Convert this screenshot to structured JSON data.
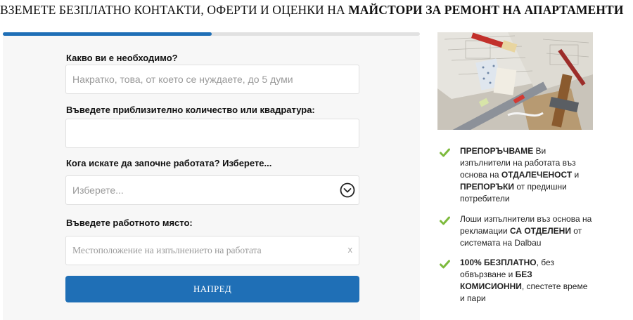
{
  "headline": {
    "normal": "ВЗЕМЕТЕ БЕЗПЛАТНО КОНТАКТИ, ОФЕРТИ И ОЦЕНКИ НА ",
    "bold": "МАЙСТОРИ ЗА РЕМОНТ НА АПАРТАМЕНТИ"
  },
  "progress": {
    "fraction": 0.5,
    "color": "#1f6fb6"
  },
  "form": {
    "need": {
      "label": "Какво ви е необходимо?",
      "placeholder": "Накратко, това, от което се нуждаете, до 5 думи",
      "value": ""
    },
    "quantity": {
      "label": "Въведете приблизително количество или квадратура:",
      "placeholder": "",
      "value": ""
    },
    "start": {
      "label": "Кога искате да започне работата? Изберете...",
      "selected": "Изберете..."
    },
    "location": {
      "label": "Въведете работното място:",
      "placeholder": "Местоположение на изпълнението на работата",
      "clear": "x"
    },
    "submit_label": "НАПРЕД"
  },
  "hero_image": {
    "icon": "renovation-tools-photo"
  },
  "benefits": [
    {
      "parts": [
        {
          "b": true,
          "t": "ПРЕПОРЪЧВАМЕ"
        },
        {
          "b": false,
          "t": " Ви изпълнители на работата въз основа на "
        },
        {
          "b": true,
          "t": "ОТДАЛЕЧЕНОСТ"
        },
        {
          "b": false,
          "t": " и "
        },
        {
          "b": true,
          "t": "ПРЕПОРЪКИ"
        },
        {
          "b": false,
          "t": " от предишни потребители"
        }
      ]
    },
    {
      "parts": [
        {
          "b": false,
          "t": "Лоши изпълнители въз основа на рекламации "
        },
        {
          "b": true,
          "t": "СА ОТДЕЛЕНИ"
        },
        {
          "b": false,
          "t": " от системата на Dalbau"
        }
      ]
    },
    {
      "parts": [
        {
          "b": true,
          "t": "100% БЕЗПЛАТНО"
        },
        {
          "b": false,
          "t": ", без обвързване и "
        },
        {
          "b": true,
          "t": "БЕЗ КОМИСИОННИ"
        },
        {
          "b": false,
          "t": ", спестете време и пари"
        }
      ]
    }
  ],
  "colors": {
    "accent": "#1f6fb6",
    "check": "#7dba3c",
    "panel": "#f7f7f7"
  }
}
